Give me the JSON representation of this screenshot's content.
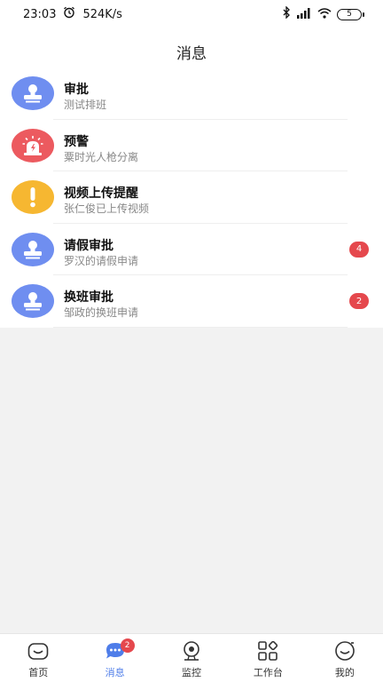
{
  "status_bar": {
    "time": "23:03",
    "speed": "524K/s",
    "battery": "5",
    "icons": [
      "alarm-icon",
      "bluetooth-icon",
      "signal-icon",
      "wifi-icon",
      "battery-icon"
    ]
  },
  "header": {
    "title": "消息"
  },
  "colors": {
    "blue": "#6f8ef0",
    "red": "#ec5a5f",
    "yellow": "#f6b731",
    "accent": "#4e7de9",
    "badge": "#e5484d"
  },
  "messages": [
    {
      "title": "审批",
      "subtitle": "测试排班",
      "icon": "stamp-icon",
      "badge": ""
    },
    {
      "title": "预警",
      "subtitle": "粟时光人枪分离",
      "icon": "alarm-light-icon",
      "badge": ""
    },
    {
      "title": "视频上传提醒",
      "subtitle": "张仁俊已上传视频",
      "icon": "exclamation-icon",
      "badge": ""
    },
    {
      "title": "请假审批",
      "subtitle": "罗汉的请假申请",
      "icon": "stamp-icon",
      "badge": "4"
    },
    {
      "title": "换班审批",
      "subtitle": "邹政的换班申请",
      "icon": "stamp-icon",
      "badge": "2"
    }
  ],
  "tabbar": {
    "items": [
      {
        "label": "首页",
        "icon": "home-icon"
      },
      {
        "label": "消息",
        "icon": "chat-icon",
        "badge": "2",
        "active": true
      },
      {
        "label": "监控",
        "icon": "camera-icon"
      },
      {
        "label": "工作台",
        "icon": "grid-icon"
      },
      {
        "label": "我的",
        "icon": "profile-icon"
      }
    ]
  }
}
